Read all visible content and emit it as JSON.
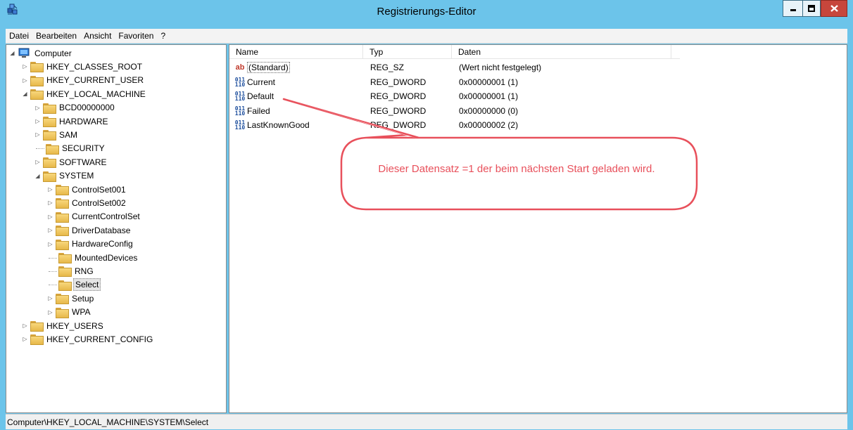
{
  "window": {
    "title": "Registrierungs-Editor"
  },
  "menu": [
    "Datei",
    "Bearbeiten",
    "Ansicht",
    "Favoriten",
    "?"
  ],
  "tree": [
    {
      "label": "Computer",
      "depth": 0,
      "expander": "open",
      "icon": "computer-icon"
    },
    {
      "label": "HKEY_CLASSES_ROOT",
      "depth": 1,
      "expander": "closed"
    },
    {
      "label": "HKEY_CURRENT_USER",
      "depth": 1,
      "expander": "closed"
    },
    {
      "label": "HKEY_LOCAL_MACHINE",
      "depth": 1,
      "expander": "open"
    },
    {
      "label": "BCD00000000",
      "depth": 2,
      "expander": "closed"
    },
    {
      "label": "HARDWARE",
      "depth": 2,
      "expander": "closed"
    },
    {
      "label": "SAM",
      "depth": 2,
      "expander": "closed"
    },
    {
      "label": "SECURITY",
      "depth": 2,
      "expander": "none"
    },
    {
      "label": "SOFTWARE",
      "depth": 2,
      "expander": "closed"
    },
    {
      "label": "SYSTEM",
      "depth": 2,
      "expander": "open"
    },
    {
      "label": "ControlSet001",
      "depth": 3,
      "expander": "closed"
    },
    {
      "label": "ControlSet002",
      "depth": 3,
      "expander": "closed"
    },
    {
      "label": "CurrentControlSet",
      "depth": 3,
      "expander": "closed"
    },
    {
      "label": "DriverDatabase",
      "depth": 3,
      "expander": "closed"
    },
    {
      "label": "HardwareConfig",
      "depth": 3,
      "expander": "closed"
    },
    {
      "label": "MountedDevices",
      "depth": 3,
      "expander": "none"
    },
    {
      "label": "RNG",
      "depth": 3,
      "expander": "none"
    },
    {
      "label": "Select",
      "depth": 3,
      "expander": "none",
      "selected": true
    },
    {
      "label": "Setup",
      "depth": 3,
      "expander": "closed"
    },
    {
      "label": "WPA",
      "depth": 3,
      "expander": "closed"
    },
    {
      "label": "HKEY_USERS",
      "depth": 1,
      "expander": "closed"
    },
    {
      "label": "HKEY_CURRENT_CONFIG",
      "depth": 1,
      "expander": "closed"
    }
  ],
  "list": {
    "columns": [
      "Name",
      "Typ",
      "Daten"
    ],
    "rows": [
      {
        "name": "(Standard)",
        "type": "REG_SZ",
        "data": "(Wert nicht festgelegt)",
        "icon": "string-value-icon"
      },
      {
        "name": "Current",
        "type": "REG_DWORD",
        "data": "0x00000001 (1)",
        "icon": "binary-value-icon"
      },
      {
        "name": "Default",
        "type": "REG_DWORD",
        "data": "0x00000001 (1)",
        "icon": "binary-value-icon"
      },
      {
        "name": "Failed",
        "type": "REG_DWORD",
        "data": "0x00000000 (0)",
        "icon": "binary-value-icon"
      },
      {
        "name": "LastKnownGood",
        "type": "REG_DWORD",
        "data": "0x00000002 (2)",
        "icon": "binary-value-icon"
      }
    ]
  },
  "callout": {
    "text": "Dieser Datensatz =1 der beim nächsten Start geladen wird.",
    "color": "#e8505b"
  },
  "statusbar": {
    "path": "Computer\\HKEY_LOCAL_MACHINE\\SYSTEM\\Select"
  }
}
